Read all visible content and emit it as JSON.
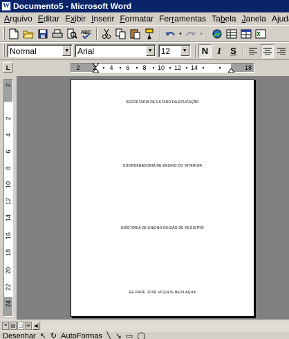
{
  "window": {
    "title": "Documento5 - Microsoft Word"
  },
  "menu": [
    {
      "label": "Arquivo",
      "hotkey_index": 0
    },
    {
      "label": "Editar",
      "hotkey_index": 0
    },
    {
      "label": "Exibir",
      "hotkey_index": 1
    },
    {
      "label": "Inserir",
      "hotkey_index": 0
    },
    {
      "label": "Formatar",
      "hotkey_index": 0
    },
    {
      "label": "Ferramentas",
      "hotkey_index": 3
    },
    {
      "label": "Tabela",
      "hotkey_index": 2
    },
    {
      "label": "Janela",
      "hotkey_index": 0
    },
    {
      "label": "Ajuda",
      "hotkey_index": 1
    }
  ],
  "formatting": {
    "style": "Normal",
    "font": "Arial",
    "size": "12",
    "bold": "N",
    "italic": "I",
    "underline": "S"
  },
  "ruler": {
    "h_numbers": [
      "2",
      "2",
      "4",
      "6",
      "8",
      "10",
      "12",
      "14",
      "18"
    ],
    "v_numbers": [
      "2",
      "2",
      "4",
      "6",
      "8",
      "10",
      "12",
      "14",
      "16",
      "18",
      "20",
      "22",
      "24"
    ]
  },
  "document": {
    "lines": [
      "SECRETARIA DE ESTADO DA EDUCAÇÃO",
      "COORDENADORIA DE ENSINO DO INTERIOR",
      "DIRETORIA DE ENSINO REGIÃO DE REGISTRO",
      "EE PROF. JOSÉ VICENTE BEVILAQUA"
    ]
  },
  "drawing_toolbar": {
    "draw_label": "Desenhar",
    "autoshapes_label": "AutoFormas"
  }
}
